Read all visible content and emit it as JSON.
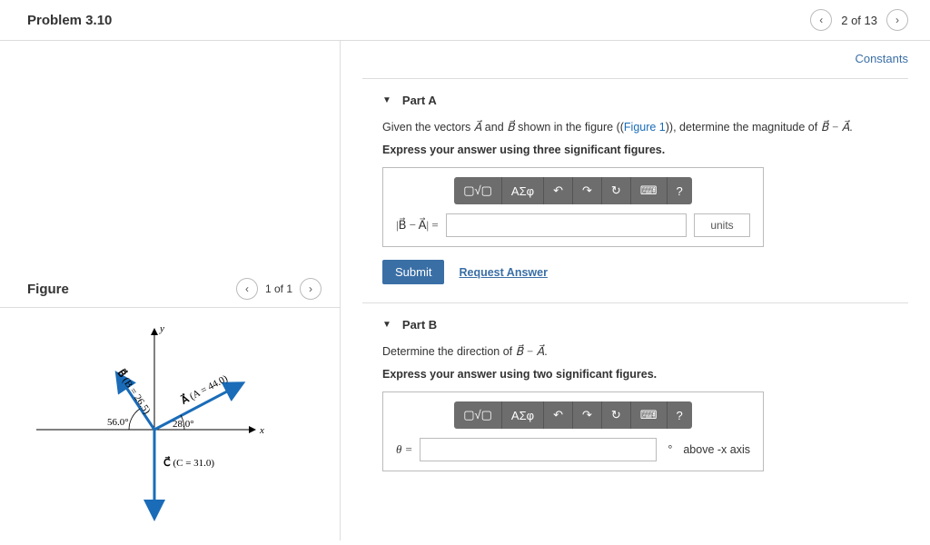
{
  "header": {
    "title": "Problem 3.10",
    "pager": "2 of 13"
  },
  "constants_label": "Constants",
  "figure": {
    "heading": "Figure",
    "pager": "1 of 1",
    "axis_x": "x",
    "axis_y": "y",
    "vectorA": {
      "label": "A",
      "magnitude": "(A = 44.0)",
      "angle_label": "28.0°"
    },
    "vectorB": {
      "label": "B",
      "magnitude": "(B = 26.5)",
      "angle_label": "56.0°"
    },
    "vectorC": {
      "label": "C",
      "magnitude": "(C = 31.0)"
    }
  },
  "partA": {
    "title": "Part A",
    "prompt_pre": "Given the vectors ",
    "prompt_vA": "A⃗",
    "prompt_mid": " and ",
    "prompt_vB": "B⃗",
    "prompt_mid2": " shown in the figure ((",
    "prompt_figlink": "Figure 1",
    "prompt_mid3": ")), determine the magnitude of ",
    "prompt_expr": "B⃗ − A⃗",
    "prompt_end": ".",
    "instruction": "Express your answer using three significant figures.",
    "lhs": "|B⃗ − A⃗| =",
    "units_placeholder": "units",
    "submit": "Submit",
    "request": "Request Answer"
  },
  "partB": {
    "title": "Part B",
    "prompt_pre": "Determine the direction of ",
    "prompt_expr": "B⃗ − A⃗",
    "prompt_end": ".",
    "instruction": "Express your answer using two significant figures.",
    "lhs": "θ =",
    "trailing": "above -x axis"
  },
  "toolbar": {
    "templates": "▢√▢",
    "greek": "ΑΣφ",
    "undo": "↶",
    "redo": "↷",
    "reset": "↻",
    "keyboard": "⌨",
    "help": "?"
  }
}
